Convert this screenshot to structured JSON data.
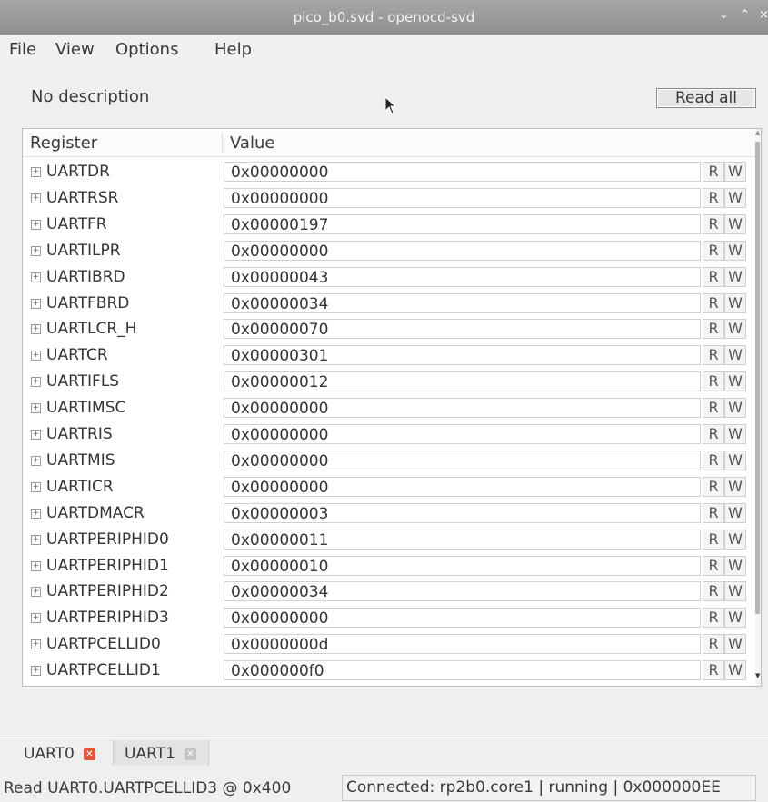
{
  "window": {
    "title": "pico_b0.svd - openocd-svd",
    "controls": {
      "minimize": "⌄",
      "maximize": "⌃",
      "close": "×"
    }
  },
  "menu": [
    "File",
    "View",
    "Options",
    "Help"
  ],
  "description": "No description",
  "read_all_label": "Read all",
  "table": {
    "headers": {
      "register": "Register",
      "value": "Value"
    },
    "read_label": "R",
    "write_label": "W",
    "expander_glyph": "+",
    "rows": [
      {
        "name": "UARTDR",
        "value": "0x00000000"
      },
      {
        "name": "UARTRSR",
        "value": "0x00000000"
      },
      {
        "name": "UARTFR",
        "value": "0x00000197"
      },
      {
        "name": "UARTILPR",
        "value": "0x00000000"
      },
      {
        "name": "UARTIBRD",
        "value": "0x00000043"
      },
      {
        "name": "UARTFBRD",
        "value": "0x00000034"
      },
      {
        "name": "UARTLCR_H",
        "value": "0x00000070"
      },
      {
        "name": "UARTCR",
        "value": "0x00000301"
      },
      {
        "name": "UARTIFLS",
        "value": "0x00000012"
      },
      {
        "name": "UARTIMSC",
        "value": "0x00000000"
      },
      {
        "name": "UARTRIS",
        "value": "0x00000000"
      },
      {
        "name": "UARTMIS",
        "value": "0x00000000"
      },
      {
        "name": "UARTICR",
        "value": "0x00000000"
      },
      {
        "name": "UARTDMACR",
        "value": "0x00000003"
      },
      {
        "name": "UARTPERIPHID0",
        "value": "0x00000011"
      },
      {
        "name": "UARTPERIPHID1",
        "value": "0x00000010"
      },
      {
        "name": "UARTPERIPHID2",
        "value": "0x00000034"
      },
      {
        "name": "UARTPERIPHID3",
        "value": "0x00000000"
      },
      {
        "name": "UARTPCELLID0",
        "value": "0x0000000d"
      },
      {
        "name": "UARTPCELLID1",
        "value": "0x000000f0"
      }
    ]
  },
  "tabs": [
    {
      "label": "UART0",
      "close_glyph": "✕",
      "active": true
    },
    {
      "label": "UART1",
      "close_glyph": "✕",
      "active": false
    }
  ],
  "status": {
    "left": "Read UART0.UARTPCELLID3 @ 0x400",
    "right": "Connected: rp2b0.core1 | running | 0x000000EE"
  },
  "colors": {
    "titlebar": "#9a9a9a",
    "active_tab_close": "#e2573c",
    "inactive_tab_close": "#c4c4c4"
  }
}
